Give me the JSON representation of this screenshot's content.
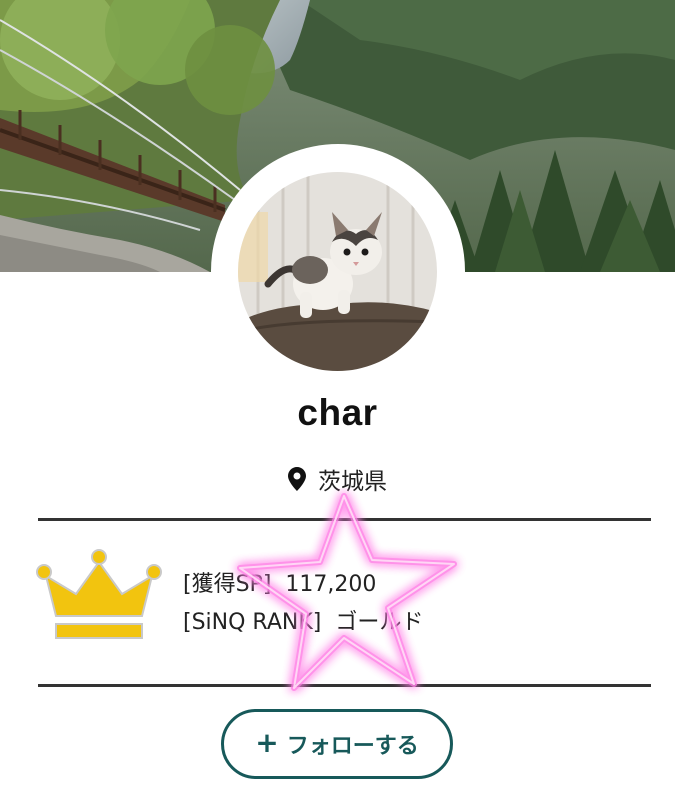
{
  "profile": {
    "username": "char",
    "location": "茨城県",
    "location_icon": "map-pin-icon"
  },
  "rank_box": {
    "icon": "crown-icon",
    "icon_color": "#f2c40f",
    "sp_label": "[獲得SP]",
    "sp_value": "117,200",
    "rank_label": "[SiNQ RANK]",
    "rank_value": "ゴールド"
  },
  "follow": {
    "plus": "+",
    "label": "フォローする",
    "color": "#17595a"
  },
  "decorations": {
    "star_color": "#ff7fe6"
  }
}
